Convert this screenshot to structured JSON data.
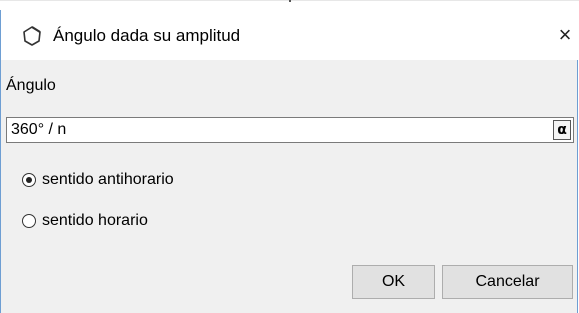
{
  "dialog": {
    "title": "Ángulo dada su amplitud",
    "close_glyph": "×",
    "title_icon": "polygon-outline-icon"
  },
  "field": {
    "label": "Ángulo",
    "value": "360° / n",
    "symbol_button": "α"
  },
  "radios": [
    {
      "label": "sentido antihorario",
      "checked": true
    },
    {
      "label": "sentido horario",
      "checked": false
    }
  ],
  "buttons": {
    "ok": "OK",
    "cancel": "Cancelar"
  }
}
